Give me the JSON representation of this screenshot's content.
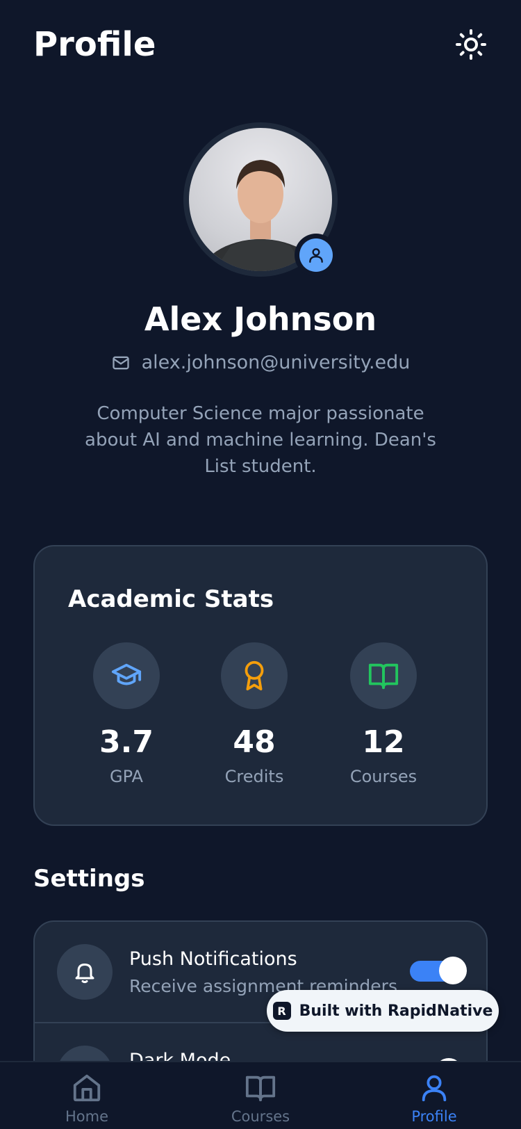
{
  "header": {
    "title": "Profile",
    "theme_toggle_icon": "sun-icon"
  },
  "profile": {
    "name": "Alex Johnson",
    "email": "alex.johnson@university.edu",
    "bio": "Computer Science major passionate about AI and machine learning. Dean's List student.",
    "badge_icon": "user-icon"
  },
  "stats": {
    "title": "Academic Stats",
    "items": [
      {
        "value": "3.7",
        "label": "GPA",
        "icon": "graduation-cap-icon",
        "color": "#60a5fa"
      },
      {
        "value": "48",
        "label": "Credits",
        "icon": "award-icon",
        "color": "#f59e0b"
      },
      {
        "value": "12",
        "label": "Courses",
        "icon": "book-open-icon",
        "color": "#22c55e"
      }
    ]
  },
  "settings": {
    "title": "Settings",
    "items": [
      {
        "label": "Push Notifications",
        "description": "Receive assignment reminders",
        "icon": "bell-icon",
        "enabled": true
      },
      {
        "label": "Dark Mode",
        "description": "",
        "icon": "moon-icon",
        "enabled": false
      }
    ]
  },
  "badge": {
    "text": "Built with RapidNative"
  },
  "tabs": [
    {
      "label": "Home",
      "icon": "home-icon",
      "active": false
    },
    {
      "label": "Courses",
      "icon": "book-icon",
      "active": false
    },
    {
      "label": "Profile",
      "icon": "user-icon",
      "active": true
    }
  ],
  "colors": {
    "background": "#0f172a",
    "card": "#1e293b",
    "accent": "#3b82f6",
    "muted_text": "#94a3b8"
  }
}
